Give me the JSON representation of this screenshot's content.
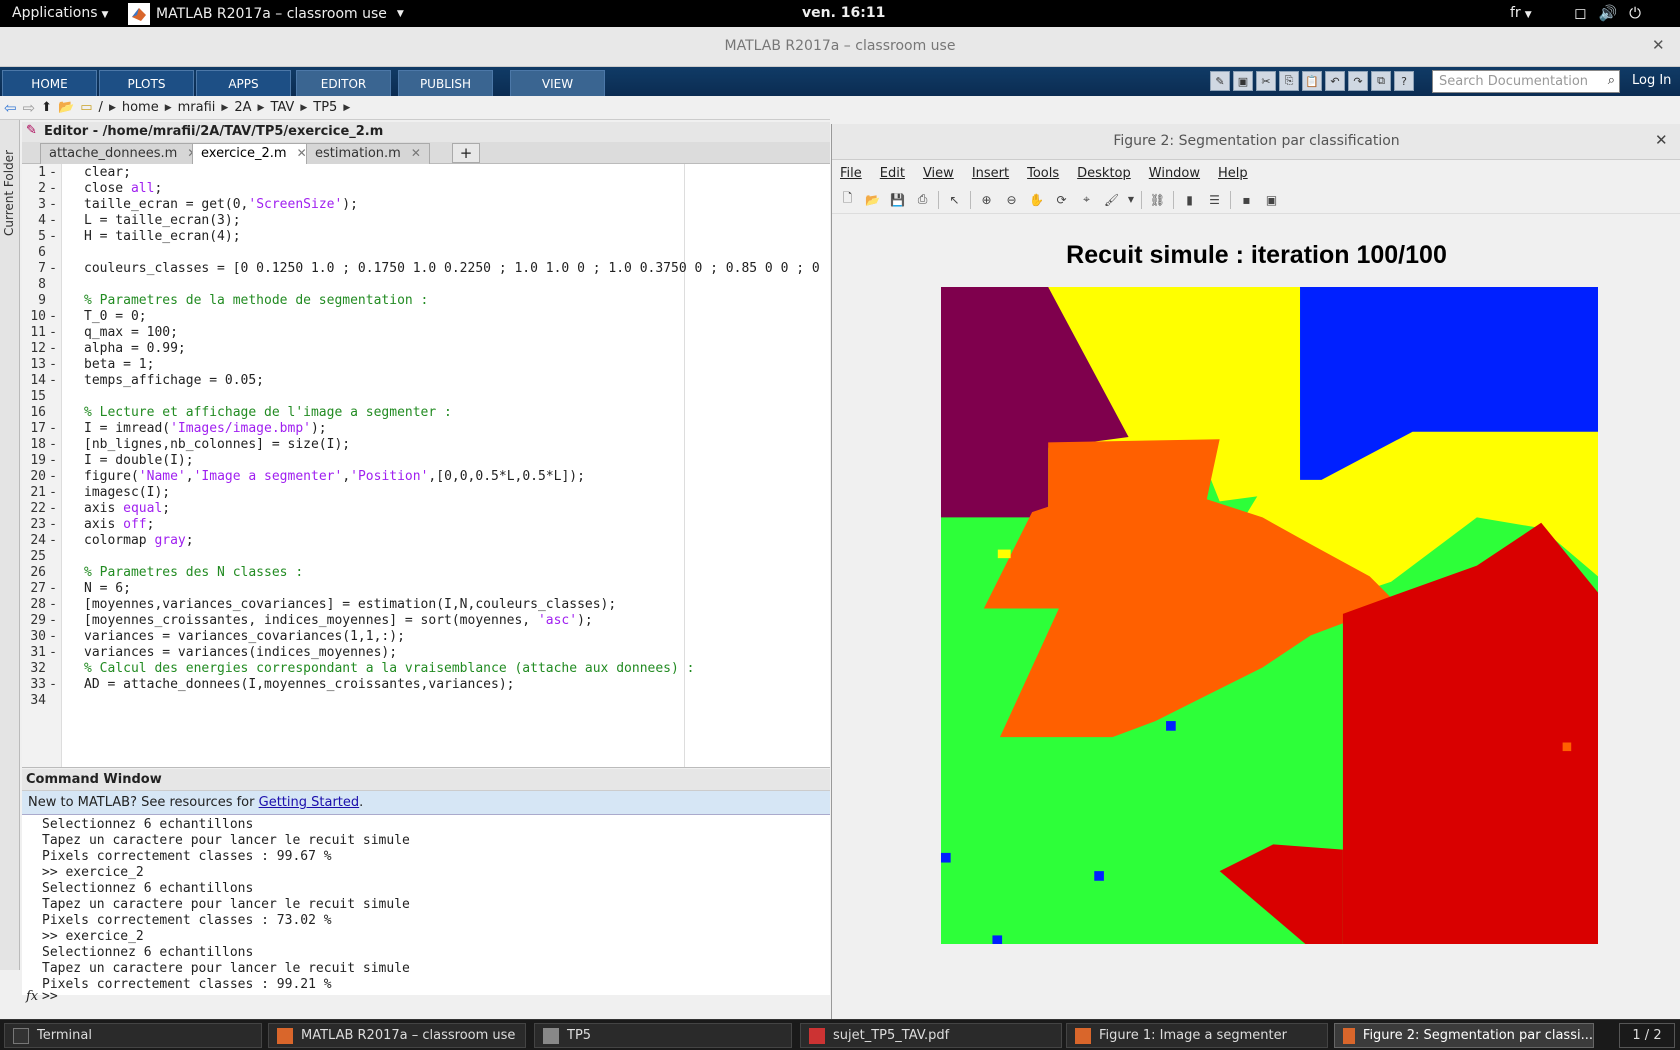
{
  "topbar": {
    "applications": "Applications",
    "window_title": "MATLAB R2017a – classroom use",
    "clock": "ven. 16:11",
    "lang": "fr"
  },
  "matlab": {
    "title": "MATLAB R2017a – classroom use",
    "tabs": [
      "HOME",
      "PLOTS",
      "APPS",
      "EDITOR",
      "PUBLISH",
      "VIEW"
    ],
    "search_placeholder": "Search Documentation",
    "login": "Log In",
    "path": [
      "/",
      "home",
      "mrafii",
      "2A",
      "TAV",
      "TP5"
    ],
    "current_folder_label": "Current Folder"
  },
  "editor": {
    "header": "Editor - /home/mrafii/2A/TAV/TP5/exercice_2.m",
    "files": [
      {
        "name": "attache_donnees.m"
      },
      {
        "name": "exercice_2.m"
      },
      {
        "name": "estimation.m"
      }
    ],
    "plus": "+",
    "lines": [
      {
        "n": "1",
        "d": "-",
        "t": "clear;"
      },
      {
        "n": "2",
        "d": "-",
        "t": "close all;"
      },
      {
        "n": "3",
        "d": "-",
        "t": "taille_ecran = get(0,'ScreenSize');"
      },
      {
        "n": "4",
        "d": "-",
        "t": "L = taille_ecran(3);"
      },
      {
        "n": "5",
        "d": "-",
        "t": "H = taille_ecran(4);"
      },
      {
        "n": "6",
        "d": "",
        "t": ""
      },
      {
        "n": "7",
        "d": "-",
        "t": "couleurs_classes = [0 0.1250 1.0 ; 0.1750 1.0 0.2250 ; 1.0 1.0 0 ; 1.0 0.3750 0 ; 0.85 0 0 ; 0"
      },
      {
        "n": "8",
        "d": "",
        "t": ""
      },
      {
        "n": "9",
        "d": "",
        "t": "% Parametres de la methode de segmentation :"
      },
      {
        "n": "10",
        "d": "-",
        "t": "T_0 = 0;"
      },
      {
        "n": "11",
        "d": "-",
        "t": "q_max = 100;"
      },
      {
        "n": "12",
        "d": "-",
        "t": "alpha = 0.99;"
      },
      {
        "n": "13",
        "d": "-",
        "t": "beta = 1;"
      },
      {
        "n": "14",
        "d": "-",
        "t": "temps_affichage = 0.05;"
      },
      {
        "n": "15",
        "d": "",
        "t": ""
      },
      {
        "n": "16",
        "d": "",
        "t": "% Lecture et affichage de l'image a segmenter :"
      },
      {
        "n": "17",
        "d": "-",
        "t": "I = imread('Images/image.bmp');"
      },
      {
        "n": "18",
        "d": "-",
        "t": "[nb_lignes,nb_colonnes] = size(I);"
      },
      {
        "n": "19",
        "d": "-",
        "t": "I = double(I);"
      },
      {
        "n": "20",
        "d": "-",
        "t": "figure('Name','Image a segmenter','Position',[0,0,0.5*L,0.5*L]);"
      },
      {
        "n": "21",
        "d": "-",
        "t": "imagesc(I);"
      },
      {
        "n": "22",
        "d": "-",
        "t": "axis equal;"
      },
      {
        "n": "23",
        "d": "-",
        "t": "axis off;"
      },
      {
        "n": "24",
        "d": "-",
        "t": "colormap gray;"
      },
      {
        "n": "25",
        "d": "",
        "t": ""
      },
      {
        "n": "26",
        "d": "",
        "t": "% Parametres des N classes :"
      },
      {
        "n": "27",
        "d": "-",
        "t": "N = 6;"
      },
      {
        "n": "28",
        "d": "-",
        "t": "[moyennes,variances_covariances] = estimation(I,N,couleurs_classes);"
      },
      {
        "n": "29",
        "d": "-",
        "t": "[moyennes_croissantes, indices_moyennes] = sort(moyennes, 'asc');"
      },
      {
        "n": "30",
        "d": "-",
        "t": "variances = variances_covariances(1,1,:);"
      },
      {
        "n": "31",
        "d": "-",
        "t": "variances = variances(indices_moyennes);"
      },
      {
        "n": "32",
        "d": "",
        "t": "% Calcul des energies correspondant a la vraisemblance (attache aux donnees) :"
      },
      {
        "n": "33",
        "d": "-",
        "t": "AD = attache_donnees(I,moyennes_croissantes,variances);"
      },
      {
        "n": "34",
        "d": "",
        "t": ""
      }
    ]
  },
  "command": {
    "header": "Command Window",
    "banner_text": "New to MATLAB? See resources for ",
    "banner_link": "Getting Started",
    "banner_end": ".",
    "lines": [
      "Selectionnez 6 echantillons",
      "Tapez un caractere pour lancer le recuit simule",
      "Pixels correctement classes : 99.67 %",
      ">> exercice_2",
      "Selectionnez 6 echantillons",
      "Tapez un caractere pour lancer le recuit simule",
      "Pixels correctement classes : 73.02 %",
      ">> exercice_2",
      "Selectionnez 6 echantillons",
      "Tapez un caractere pour lancer le recuit simule",
      "Pixels correctement classes : 99.21 %"
    ],
    "fx": "fx",
    "prompt": ">>"
  },
  "figure": {
    "title": "Figure 2: Segmentation par classification",
    "menu": [
      "File",
      "Edit",
      "View",
      "Insert",
      "Tools",
      "Desktop",
      "Window",
      "Help"
    ],
    "plot_title": "Recuit simule : iteration 100/100",
    "colors": {
      "blue": "#0020ff",
      "green": "#2dff39",
      "yellow": "#ffff00",
      "orange": "#ff6000",
      "red": "#d90000",
      "purple": "#7f004d"
    }
  },
  "taskbar": {
    "items": [
      "Terminal",
      "MATLAB R2017a – classroom use",
      "TP5",
      "sujet_TP5_TAV.pdf",
      "Figure 1: Image a segmenter",
      "Figure 2: Segmentation par classi..."
    ],
    "pager": "1 / 2"
  }
}
